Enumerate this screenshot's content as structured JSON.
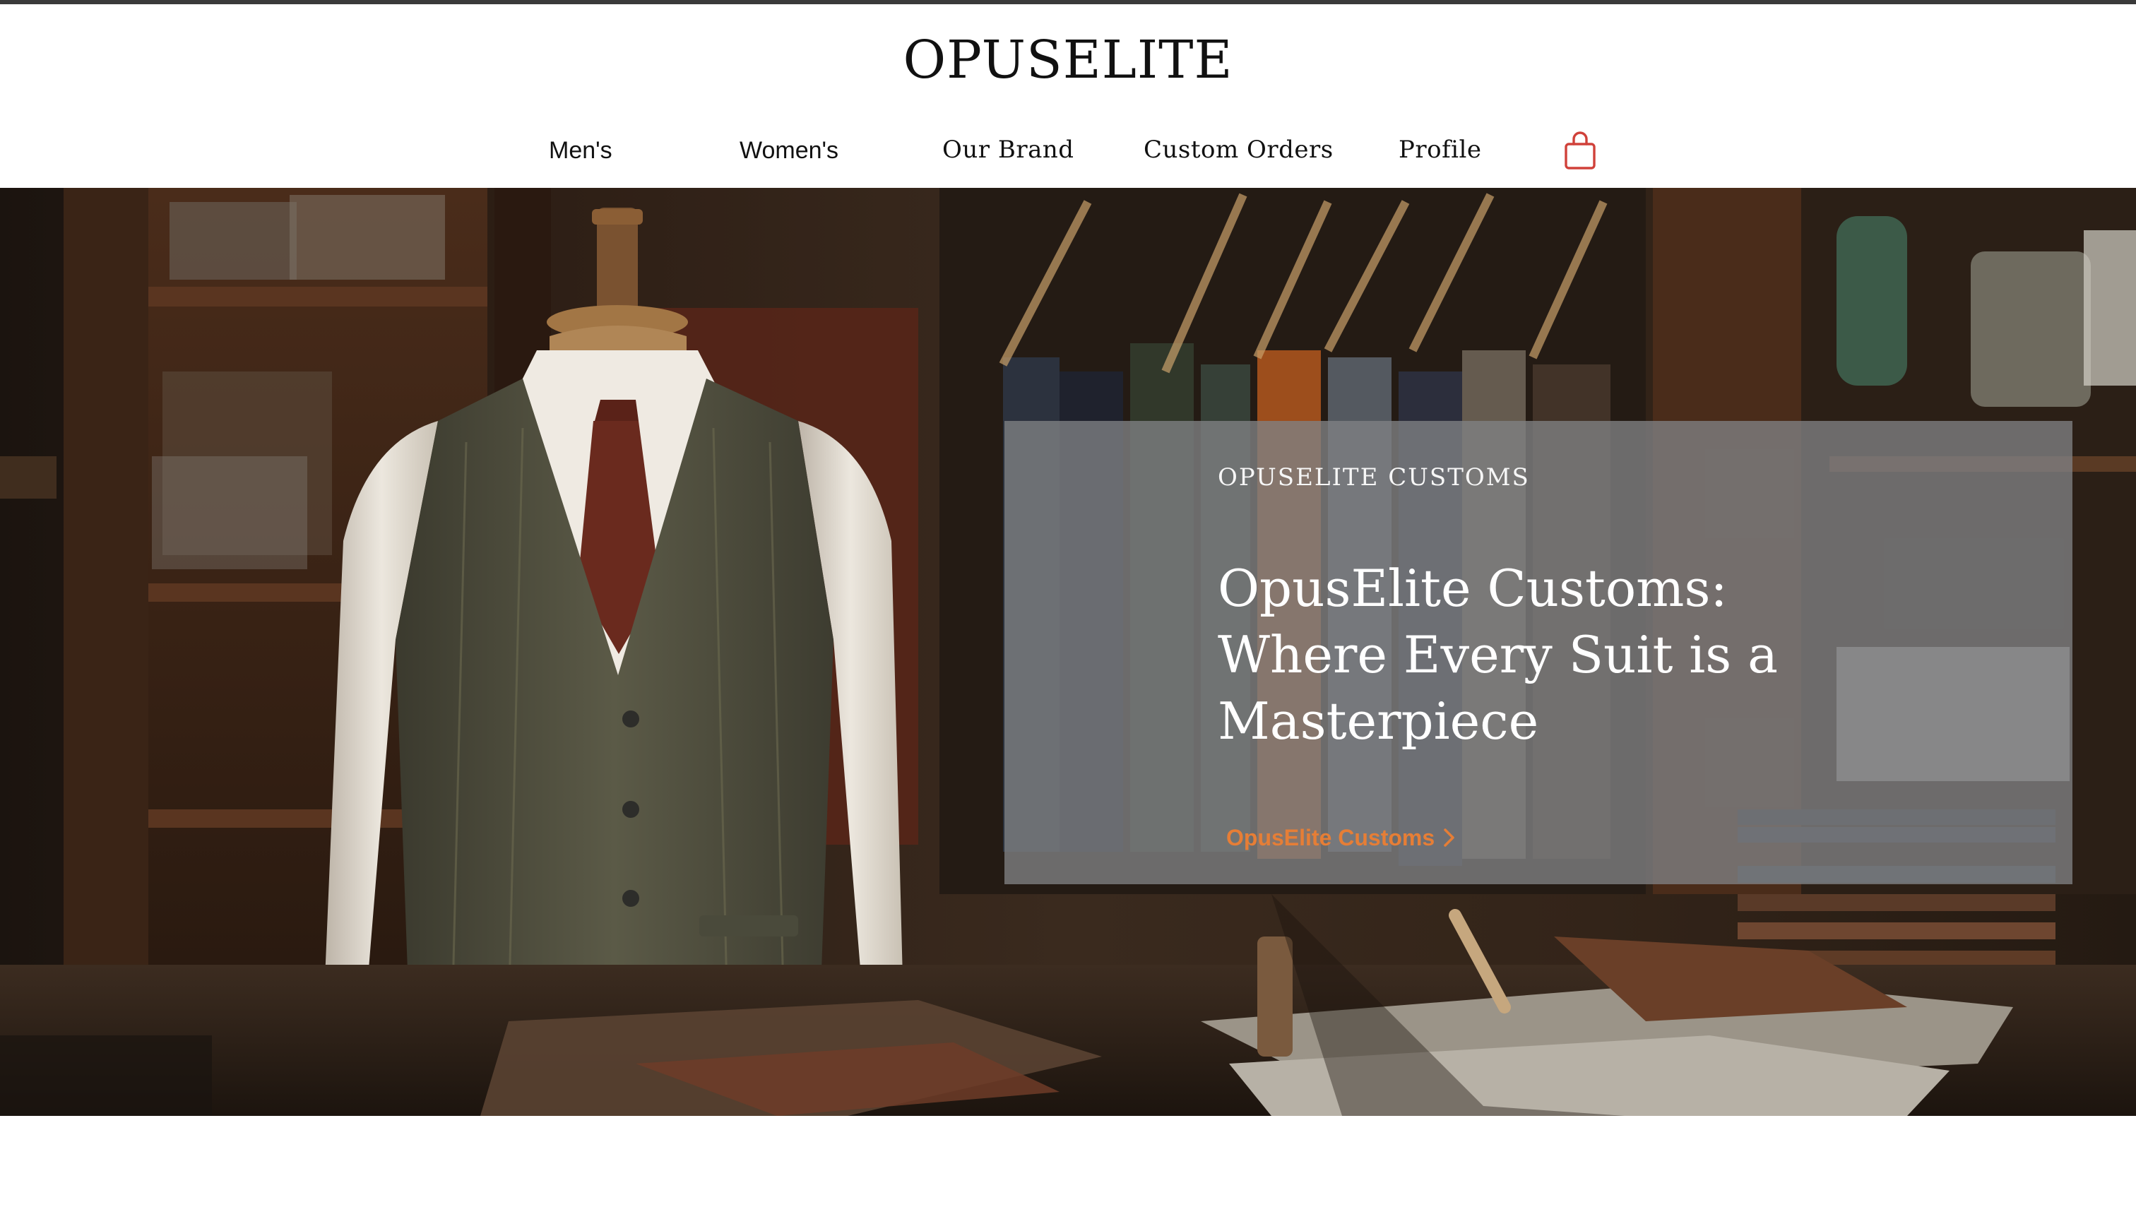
{
  "brand": {
    "logo": "OPUSELITE"
  },
  "nav": {
    "items": [
      {
        "label": "Men's"
      },
      {
        "label": "Women's"
      },
      {
        "label": "Our Brand"
      },
      {
        "label": "Custom Orders"
      },
      {
        "label": "Profile"
      }
    ],
    "cart_icon": "shopping-bag-icon"
  },
  "hero": {
    "image": "tailor-shop-mannequin-image",
    "kicker": "OPUSELITE CUSTOMS",
    "headline": "OpusElite Customs: Where Every Suit is a Masterpiece",
    "cta_label": "OpusElite Customs",
    "cta_icon": "chevron-right-icon"
  },
  "colors": {
    "accent": "#e67e36",
    "cart": "#d0413a",
    "overlay": "#808284",
    "text_dark": "#111111",
    "top_rule": "#3a3a3a"
  }
}
